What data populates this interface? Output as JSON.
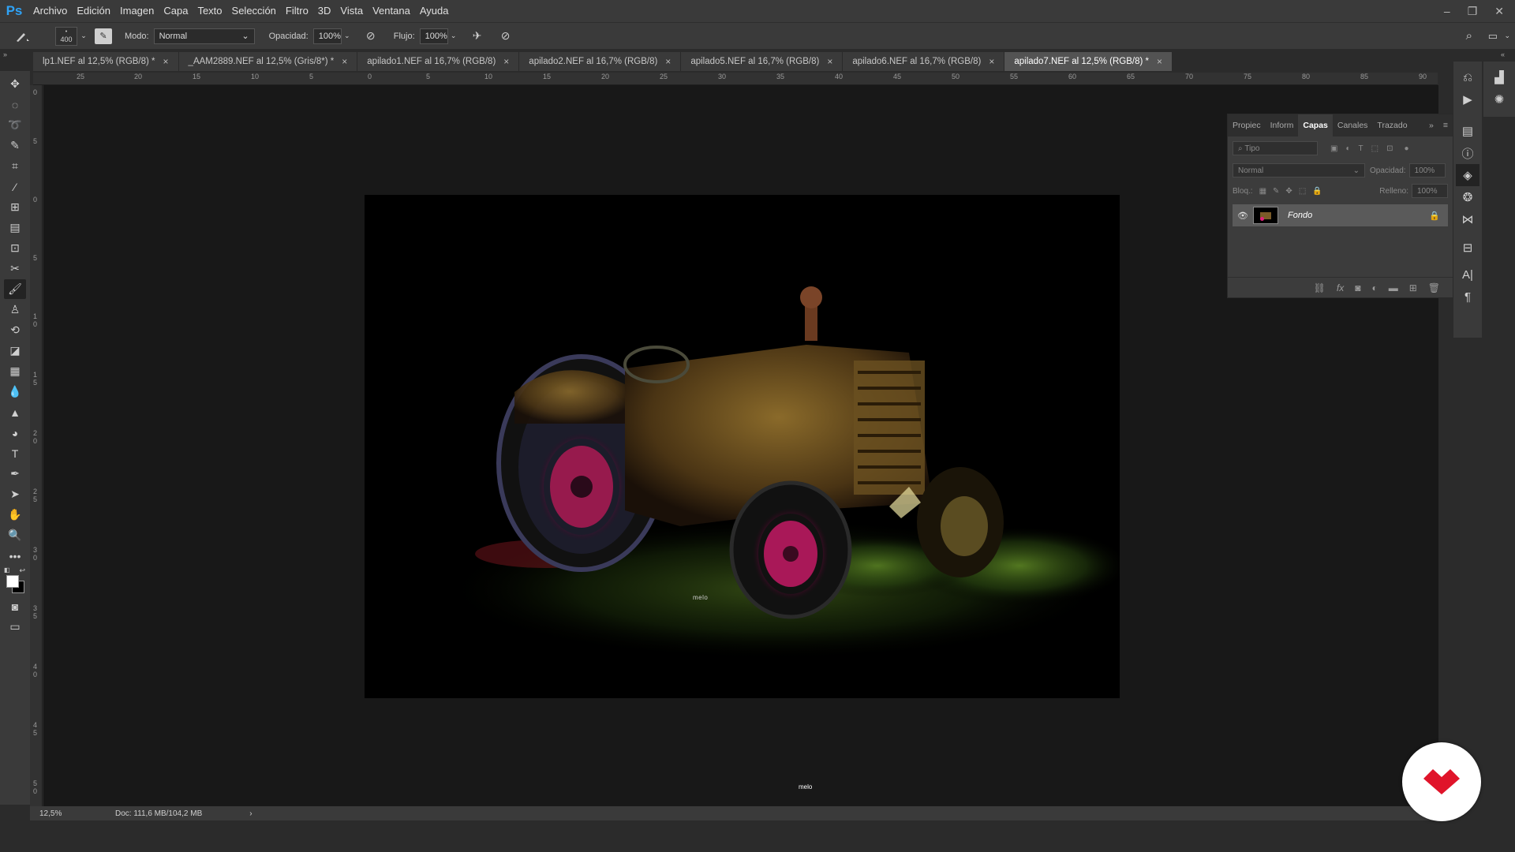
{
  "app": {
    "logo": "Ps",
    "accent": "#2fa3f7"
  },
  "menu": [
    "Archivo",
    "Edición",
    "Imagen",
    "Capa",
    "Texto",
    "Selección",
    "Filtro",
    "3D",
    "Vista",
    "Ventana",
    "Ayuda"
  ],
  "window_controls": {
    "minimize": "–",
    "restore": "❐",
    "close": "✕"
  },
  "options": {
    "brush_size": "400",
    "mode_label": "Modo:",
    "mode_value": "Normal",
    "opacity_label": "Opacidad:",
    "opacity_value": "100%",
    "flow_label": "Flujo:",
    "flow_value": "100%"
  },
  "tabs": [
    {
      "label": "lp1.NEF al 12,5% (RGB/8) *",
      "close": "×"
    },
    {
      "label": "_AAM2889.NEF al 12,5% (Gris/8*) *",
      "close": "×"
    },
    {
      "label": "apilado1.NEF al 16,7% (RGB/8)",
      "close": "×"
    },
    {
      "label": "apilado2.NEF al 16,7% (RGB/8)",
      "close": "×"
    },
    {
      "label": "apilado5.NEF al 16,7% (RGB/8)",
      "close": "×"
    },
    {
      "label": "apilado6.NEF al 16,7% (RGB/8)",
      "close": "×"
    },
    {
      "label": "apilado7.NEF al 12,5% (RGB/8) *",
      "close": "×"
    }
  ],
  "ruler_top_ticks": [
    "25",
    "20",
    "15",
    "10",
    "5",
    "0",
    "5",
    "10",
    "15",
    "20",
    "25",
    "30",
    "35",
    "40",
    "45",
    "50",
    "55",
    "60",
    "65",
    "70",
    "75",
    "80",
    "85",
    "90"
  ],
  "ruler_left_ticks": [
    "0",
    "5",
    "0",
    "5",
    "1 0",
    "1 5",
    "2 0",
    "2 5",
    "3 0",
    "3 5",
    "4 0",
    "4 5",
    "5 0"
  ],
  "layers_panel": {
    "tabs": [
      "Propiec",
      "Inform",
      "Capas",
      "Canales",
      "Trazado"
    ],
    "active_tab": "Capas",
    "search_placeholder": "Tipo",
    "blend_mode": "Normal",
    "opacity_label": "Opacidad:",
    "opacity_value": "100%",
    "lock_label": "Bloq.:",
    "fill_label": "Relleno:",
    "fill_value": "100%",
    "layers": [
      {
        "name": "Fondo",
        "visible": true,
        "locked": true
      }
    ],
    "footer_icons": [
      "link-icon",
      "fx-icon",
      "mask-icon",
      "adjustment-icon",
      "folder-icon",
      "new-layer-icon",
      "trash-icon"
    ]
  },
  "canvas": {
    "watermark": "melo",
    "canvas_mark": "melo"
  },
  "status": {
    "zoom": "12,5%",
    "doc": "Doc: 111,6 MB/104,2 MB",
    "arrow": "›"
  },
  "badge": {
    "brand_color": "#e0142a"
  }
}
